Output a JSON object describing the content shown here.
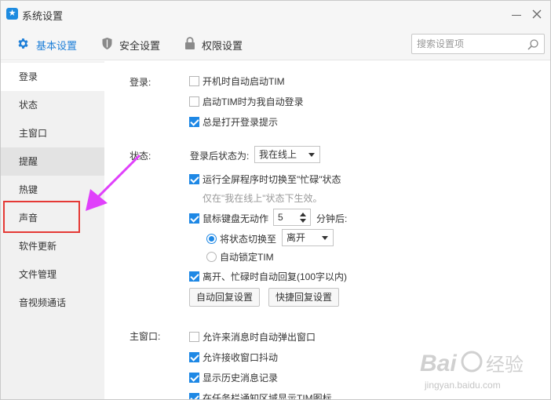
{
  "window": {
    "title": "系统设置"
  },
  "tabs": [
    {
      "label": "基本设置",
      "icon": "gear-icon",
      "active": true
    },
    {
      "label": "安全设置",
      "icon": "shield-icon",
      "active": false
    },
    {
      "label": "权限设置",
      "icon": "lock-icon",
      "active": false
    }
  ],
  "search": {
    "placeholder": "搜索设置项",
    "value": ""
  },
  "sidebar": {
    "items": [
      {
        "label": "登录"
      },
      {
        "label": "状态"
      },
      {
        "label": "主窗口"
      },
      {
        "label": "提醒"
      },
      {
        "label": "热键"
      },
      {
        "label": "声音"
      },
      {
        "label": "软件更新"
      },
      {
        "label": "文件管理"
      },
      {
        "label": "音视频通话"
      }
    ],
    "active_index": 0,
    "highlighted_item": "声音"
  },
  "login": {
    "label": "登录:",
    "opt1": "开机时自动启动TIM",
    "opt2": "启动TIM时为我自动登录",
    "opt3": "总是打开登录提示"
  },
  "status": {
    "label": "状态:",
    "after_login_label": "登录后状态为:",
    "after_login_value": "我在线上",
    "fullscreen": "运行全屏程序时切换至\"忙碌\"状态",
    "fullscreen_hint": "仅在\"我在线上\"状态下生效。",
    "idle_prefix": "鼠标键盘无动作",
    "idle_minutes": "5",
    "idle_suffix": "分钟后:",
    "switch_to_label": "将状态切换至",
    "switch_to_value": "离开",
    "auto_lock": "自动锁定TIM",
    "auto_reply": "离开、忙碌时自动回复(100字以内)",
    "auto_reply_btn": "自动回复设置",
    "quick_reply_btn": "快捷回复设置"
  },
  "main_window": {
    "label": "主窗口:",
    "opt1": "允许来消息时自动弹出窗口",
    "opt2": "允许接收窗口抖动",
    "opt3": "显示历史消息记录",
    "opt4": "在任务栏通知区域显示TIM图标"
  },
  "watermark": {
    "brand": "Bai",
    "brand_cn": "经验",
    "url": "jingyan.baidu.com"
  },
  "colors": {
    "accent": "#1e88e5",
    "annotation_arrow": "#e040fb",
    "annotation_box": "#e53935"
  }
}
